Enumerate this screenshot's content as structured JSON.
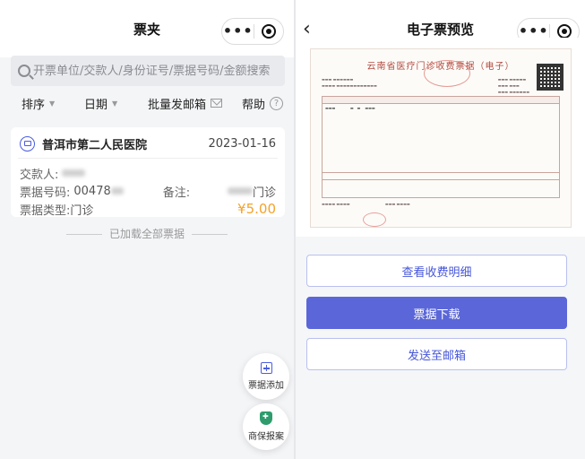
{
  "left": {
    "title": "票夹",
    "search_placeholder": "开票单位/交款人/身份证号/票据号码/金额搜索",
    "filters": {
      "sort": "排序",
      "date": "日期",
      "batch_mail": "批量发邮箱",
      "help": "帮助"
    },
    "card": {
      "hospital": "普洱市第二人民医院",
      "date": "2023-01-16",
      "payer_label": "交款人:",
      "number_label": "票据号码:",
      "number_value": "00478",
      "remark_label": "备注:",
      "remark_value": "门诊",
      "type_label": "票据类型:",
      "type_value": "门诊",
      "amount": "¥5.00"
    },
    "loaded_text": "已加载全部票据",
    "fab_add": "票据添加",
    "fab_insurance": "商保报案"
  },
  "right": {
    "title": "电子票预览",
    "invoice_title": "云南省医疗门诊收费票据（电子）",
    "buttons": {
      "details": "查看收费明细",
      "download": "票据下载",
      "send_mail": "发送至邮箱"
    }
  },
  "icons": {
    "menu": "more-dots-icon",
    "close": "target-circle-icon",
    "back": "chevron-left-icon"
  },
  "colors": {
    "accent": "#5b67d8",
    "price": "#f3a32c"
  }
}
